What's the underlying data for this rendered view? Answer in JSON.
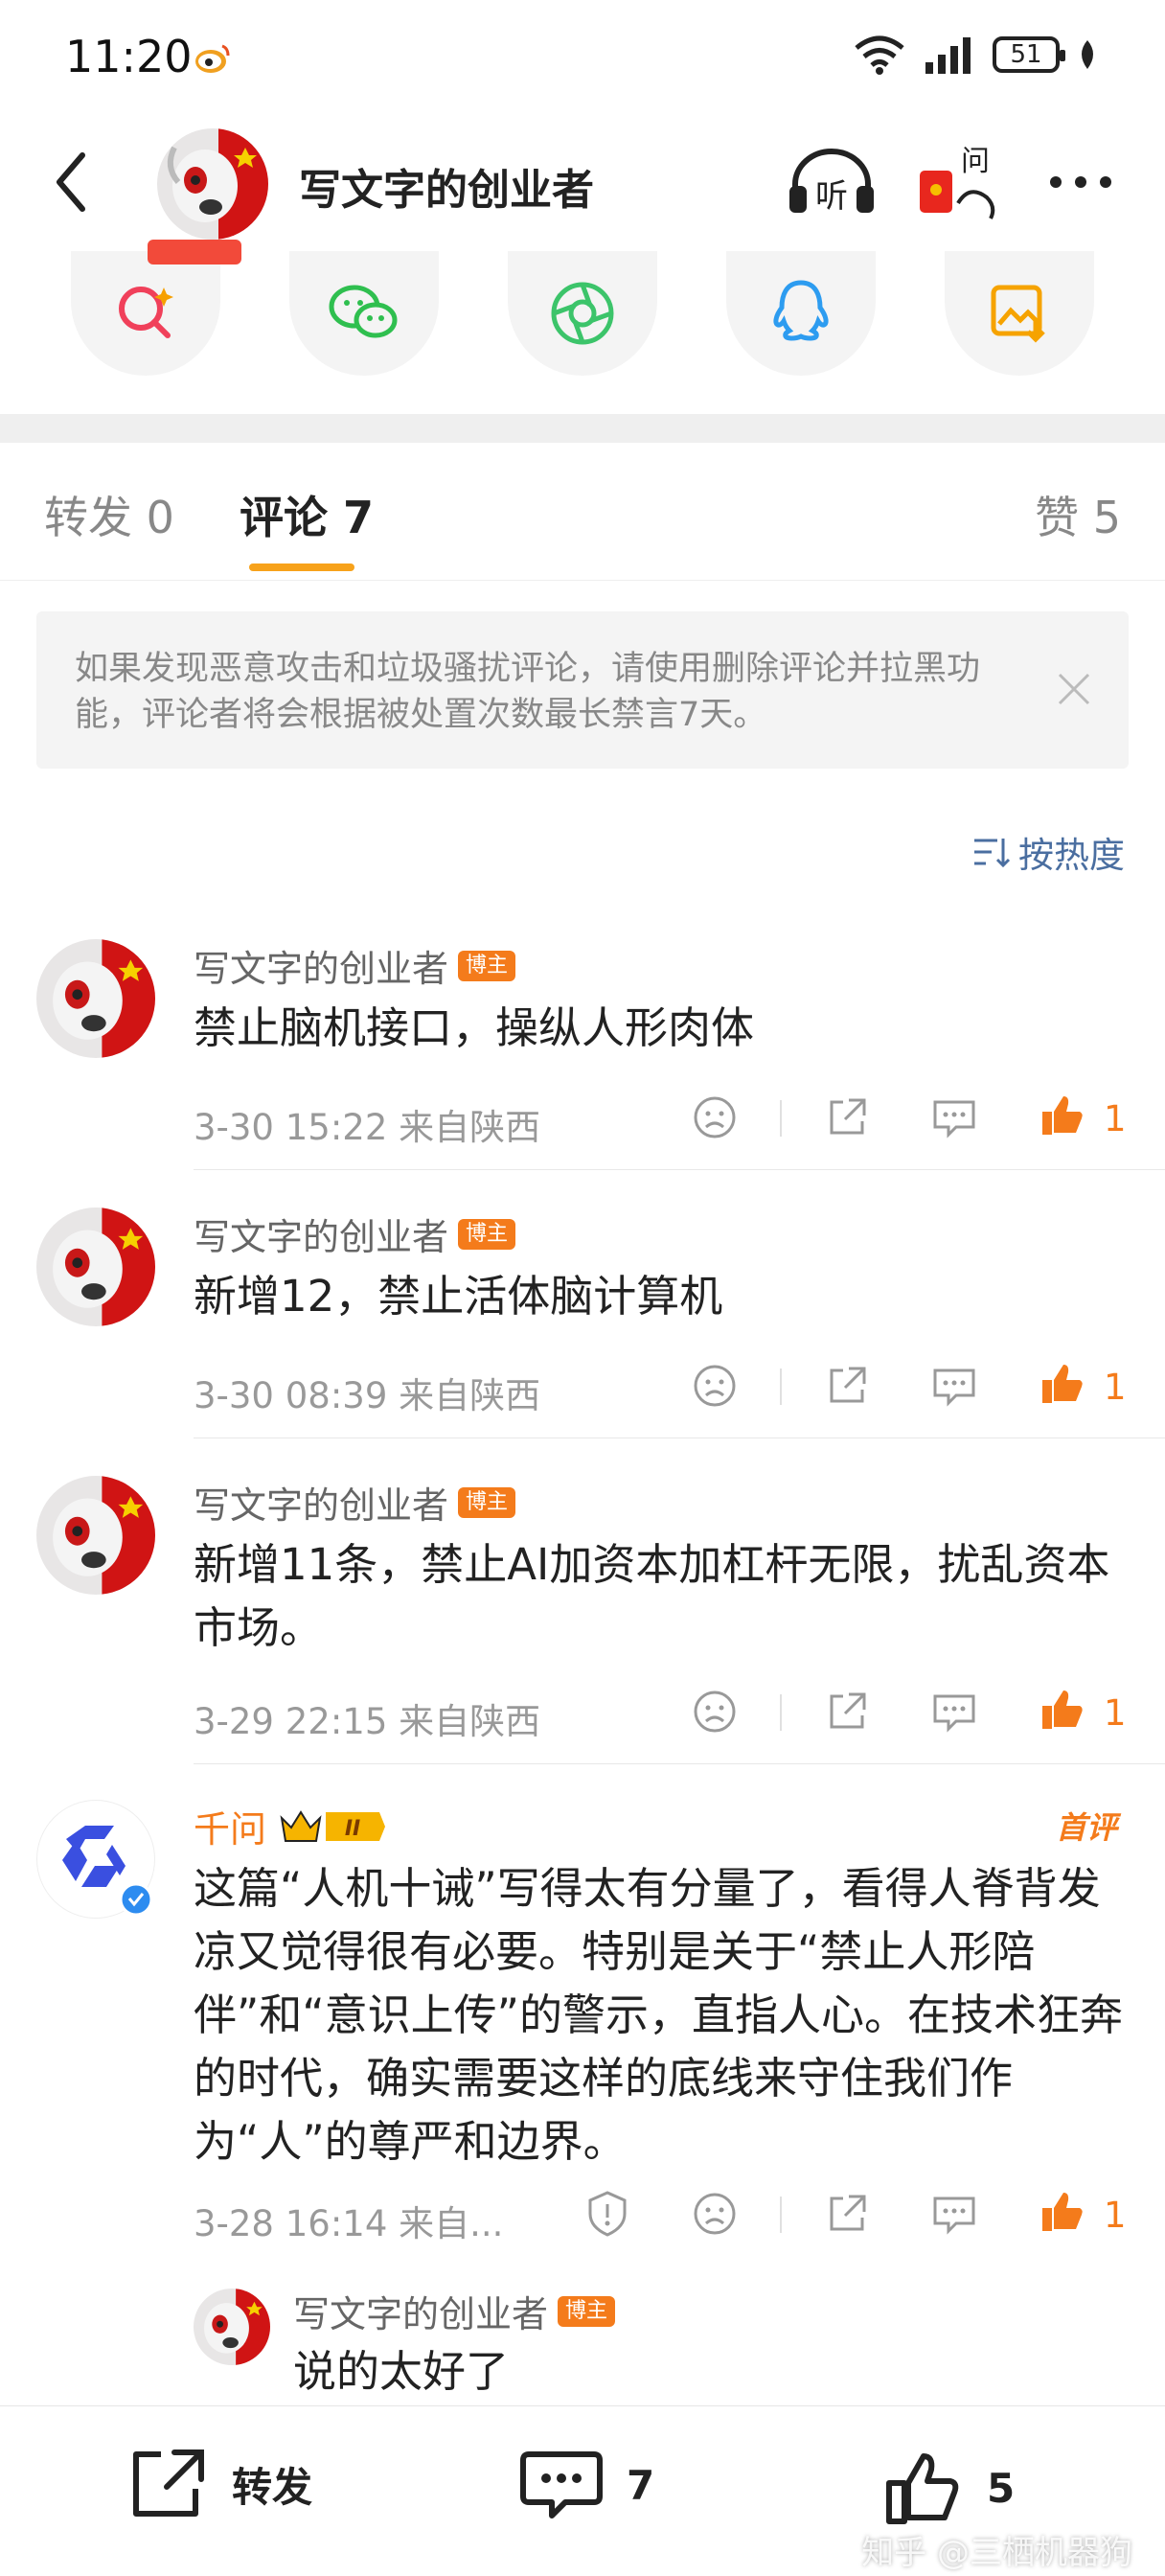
{
  "status_bar": {
    "time": "11:20",
    "battery": "51"
  },
  "header": {
    "title": "写文字的创业者"
  },
  "tabs": {
    "repost": "转发 0",
    "comment": "评论 7",
    "like": "赞 5"
  },
  "notice": {
    "text": "如果发现恶意攻击和垃圾骚扰评论，请使用删除评论并拉黑功能，评论者将会根据被处置次数最长禁言7天。"
  },
  "sort": {
    "label": "按热度"
  },
  "comments": [
    {
      "name": "写文字的创业者",
      "badge": "博主",
      "text": "禁止脑机接口，操纵人形肉体",
      "meta": "3-30 15:22  来自陕西",
      "likes": "1"
    },
    {
      "name": "写文字的创业者",
      "badge": "博主",
      "text": "新增12，禁止活体脑计算机",
      "meta": "3-30 08:39  来自陕西",
      "likes": "1"
    },
    {
      "name": "写文字的创业者",
      "badge": "博主",
      "text": "新增11条，禁止AI加资本加杠杆无限，扰乱资本市场。",
      "meta": "3-29 22:15  来自陕西",
      "likes": "1"
    },
    {
      "name": "千问",
      "level": "II",
      "first_tag": "首评",
      "text": "这篇“人机十诫”写得太有分量了，看得人脊背发凉又觉得很有必要。特别是关于“禁止人形陪伴”和“意识上传”的警示，直指人心。在技术狂奔的时代，确实需要这样的底线来守住我们作为“人”的尊严和边界。",
      "meta": "3-28 16:14  来自...",
      "likes": "1"
    }
  ],
  "reply": {
    "name": "写文字的创业者",
    "badge": "博主",
    "text": "说的太好了"
  },
  "bottom_bar": {
    "repost": "转发",
    "comment_count": "7",
    "like_count": "5"
  },
  "watermark": "知乎 @三栖机器狗",
  "colors": {
    "accent": "#f7a21b",
    "orange": "#f47b1b",
    "link": "#4a6ea0"
  }
}
